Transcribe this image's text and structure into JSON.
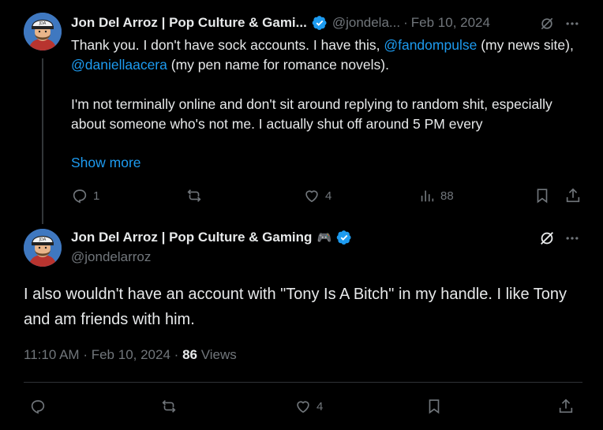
{
  "reply": {
    "author_name": "Jon Del Arroz | Pop Culture & Gami...",
    "handle": "@jondela...",
    "separator": "·",
    "date": "Feb 10, 2024",
    "text_line1_a": "Thank you. I don't have sock accounts. I have this, ",
    "mention1": "@fandompulse",
    "text_line1_b": " (my news site), ",
    "mention2": "@daniellaacera",
    "text_line1_c": " (my pen name for romance novels).",
    "text_para2": "I'm not terminally online and don't sit around replying to random shit, especially about someone who's not me. I actually shut off around 5 PM every",
    "show_more": "Show more",
    "actions": {
      "replies": "1",
      "reposts": "",
      "likes": "4",
      "views": "88"
    }
  },
  "main": {
    "author_name": "Jon Del Arroz | Pop Culture & Gaming",
    "gamepad_emoji": "🎮",
    "handle": "@jondelarroz",
    "text": "I also wouldn't have an account with \"Tony Is A Bitch\" in my handle. I like Tony and am friends with him.",
    "time": "11:10 AM",
    "separator": "·",
    "date": "Feb 10, 2024",
    "views_count": "86",
    "views_label": "Views",
    "actions": {
      "reposts": "",
      "likes": "4"
    }
  },
  "colors": {
    "background": "#000000",
    "text": "#e7e9ea",
    "muted": "#71767b",
    "accent": "#1d9bf0",
    "verified": "#1d9bf0"
  },
  "icons": {
    "reply": "comment-bubble-icon",
    "repost": "repost-arrows-icon",
    "like": "heart-icon",
    "views": "bar-chart-icon",
    "bookmark": "bookmark-icon",
    "share": "share-upload-icon",
    "grok": "grok-icon",
    "more": "more-dots-icon",
    "verified": "verified-badge-icon"
  }
}
